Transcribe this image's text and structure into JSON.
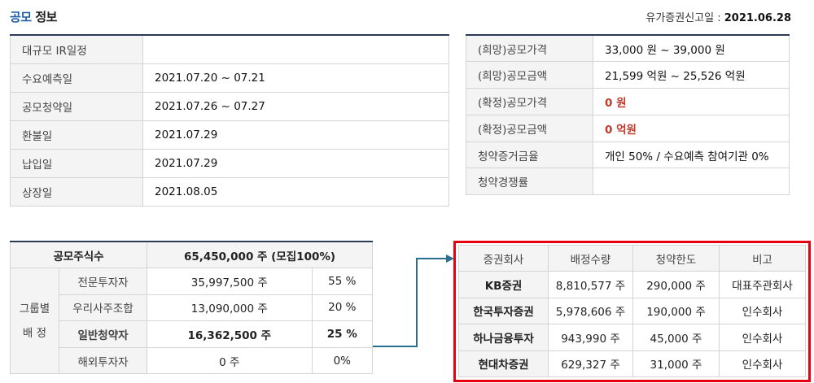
{
  "header": {
    "title_accent": "공모",
    "title_rest": "정보",
    "report_label": "유가증권신고일 :",
    "report_date": "2021.06.28"
  },
  "schedule": [
    {
      "label": "대규모 IR일정",
      "value": ""
    },
    {
      "label": "수요예측일",
      "value": "2021.07.20 ~ 07.21"
    },
    {
      "label": "공모청약일",
      "value": "2021.07.26 ~ 07.27"
    },
    {
      "label": "환불일",
      "value": "2021.07.29"
    },
    {
      "label": "납입일",
      "value": "2021.07.29"
    },
    {
      "label": "상장일",
      "value": "2021.08.05"
    }
  ],
  "pricing": [
    {
      "label": "(희망)공모가격",
      "value": "33,000 원 ~ 39,000 원"
    },
    {
      "label": "(희망)공모금액",
      "value": "21,599 억원  ~ 25,526 억원"
    },
    {
      "label": "(확정)공모가격",
      "value": "0 원"
    },
    {
      "label": "(확정)공모금액",
      "value": "0 억원"
    },
    {
      "label": "청약증거금율",
      "value": "개인 50% / 수요예측 참여기관 0%"
    },
    {
      "label": "청약경쟁률",
      "value": ""
    }
  ],
  "shares": {
    "total_label": "공모주식수",
    "total_value": "65,450,000 주 (모집100%)",
    "group_label_1": "그룹별",
    "group_label_2": "배 정",
    "rows": [
      {
        "name": "전문투자자",
        "amount": "35,997,500 주",
        "pct": "55 %"
      },
      {
        "name": "우리사주조합",
        "amount": "13,090,000 주",
        "pct": "20 %"
      },
      {
        "name": "일반청약자",
        "amount": "16,362,500 주",
        "pct": "25 %"
      },
      {
        "name": "해외투자자",
        "amount": "0 주",
        "pct": "0%"
      }
    ]
  },
  "brokers": {
    "headers": [
      "증권회사",
      "배정수량",
      "청약한도",
      "비고"
    ],
    "rows": [
      {
        "firm": "KB증권",
        "allocation": "8,810,577 주",
        "limit": "290,000 주",
        "note": "대표주관회사"
      },
      {
        "firm": "한국투자증권",
        "allocation": "5,978,606 주",
        "limit": "190,000 주",
        "note": "인수회사"
      },
      {
        "firm": "하나금융투자",
        "allocation": "943,990 주",
        "limit": "45,000 주",
        "note": "인수회사"
      },
      {
        "firm": "현대차증권",
        "allocation": "629,327 주",
        "limit": "31,000 주",
        "note": "인수회사"
      }
    ]
  },
  "colors": {
    "accent": "#1e5fa8",
    "highlight_box": "#e60012",
    "arrow": "#2a6f8f",
    "confirmed_value": "#c0392b"
  }
}
